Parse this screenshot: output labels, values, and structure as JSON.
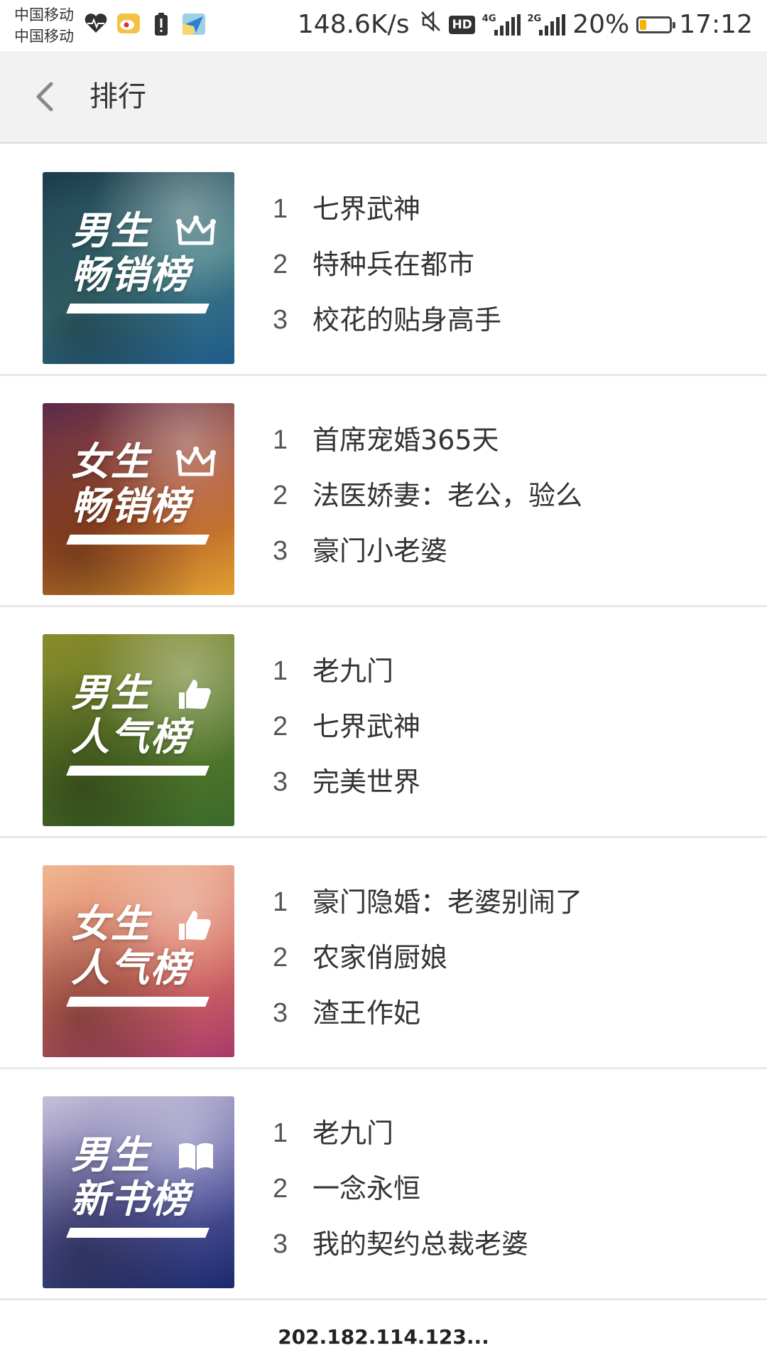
{
  "status_bar": {
    "carrier_1": "中国移动",
    "carrier_2": "中国移动",
    "left_icons": [
      "heart-rate-icon",
      "weibo-icon",
      "battery-alert-icon",
      "send-app-icon"
    ],
    "net_speed": "148.6K/s",
    "network_4g": "4G",
    "network_2g": "2G",
    "hd_label": "HD",
    "battery_percent": "20%",
    "battery_level": 0.2,
    "time": "17:12"
  },
  "header": {
    "back_icon": "chevron-left-icon",
    "title": "排行"
  },
  "rankings": [
    {
      "cover_line1": "男生",
      "cover_line2": "畅销榜",
      "cover_icon": "crown-icon",
      "cover_colors": [
        "#1c3a4a",
        "#3f7a82",
        "#1f5a8a"
      ],
      "books": [
        {
          "rank": "1",
          "title": "七界武神"
        },
        {
          "rank": "2",
          "title": "特种兵在都市"
        },
        {
          "rank": "3",
          "title": "校花的贴身高手"
        }
      ]
    },
    {
      "cover_line1": "女生",
      "cover_line2": "畅销榜",
      "cover_icon": "crown-icon",
      "cover_colors": [
        "#5a2a4a",
        "#b0532a",
        "#e0a030"
      ],
      "books": [
        {
          "rank": "1",
          "title": "首席宠婚365天"
        },
        {
          "rank": "2",
          "title": "法医娇妻：老公，验么"
        },
        {
          "rank": "3",
          "title": "豪门小老婆"
        }
      ]
    },
    {
      "cover_line1": "男生",
      "cover_line2": "人气榜",
      "cover_icon": "thumbs-up-icon",
      "cover_colors": [
        "#8a8a2a",
        "#5a7a2a",
        "#3a6a2a"
      ],
      "books": [
        {
          "rank": "1",
          "title": "老九门"
        },
        {
          "rank": "2",
          "title": "七界武神"
        },
        {
          "rank": "3",
          "title": "完美世界"
        }
      ]
    },
    {
      "cover_line1": "女生",
      "cover_line2": "人气榜",
      "cover_icon": "thumbs-up-icon",
      "cover_colors": [
        "#f0b890",
        "#d87060",
        "#a83a6a"
      ],
      "books": [
        {
          "rank": "1",
          "title": "豪门隐婚：老婆别闹了"
        },
        {
          "rank": "2",
          "title": "农家俏厨娘"
        },
        {
          "rank": "3",
          "title": "渣王作妃"
        }
      ]
    },
    {
      "cover_line1": "男生",
      "cover_line2": "新书榜",
      "cover_icon": "book-icon",
      "cover_colors": [
        "#c8c0d8",
        "#5a5aa0",
        "#1a2a6a"
      ],
      "books": [
        {
          "rank": "1",
          "title": "老九门"
        },
        {
          "rank": "2",
          "title": "一念永恒"
        },
        {
          "rank": "3",
          "title": "我的契约总裁老婆"
        }
      ]
    }
  ],
  "footer": {
    "url": "202.182.114.123..."
  }
}
